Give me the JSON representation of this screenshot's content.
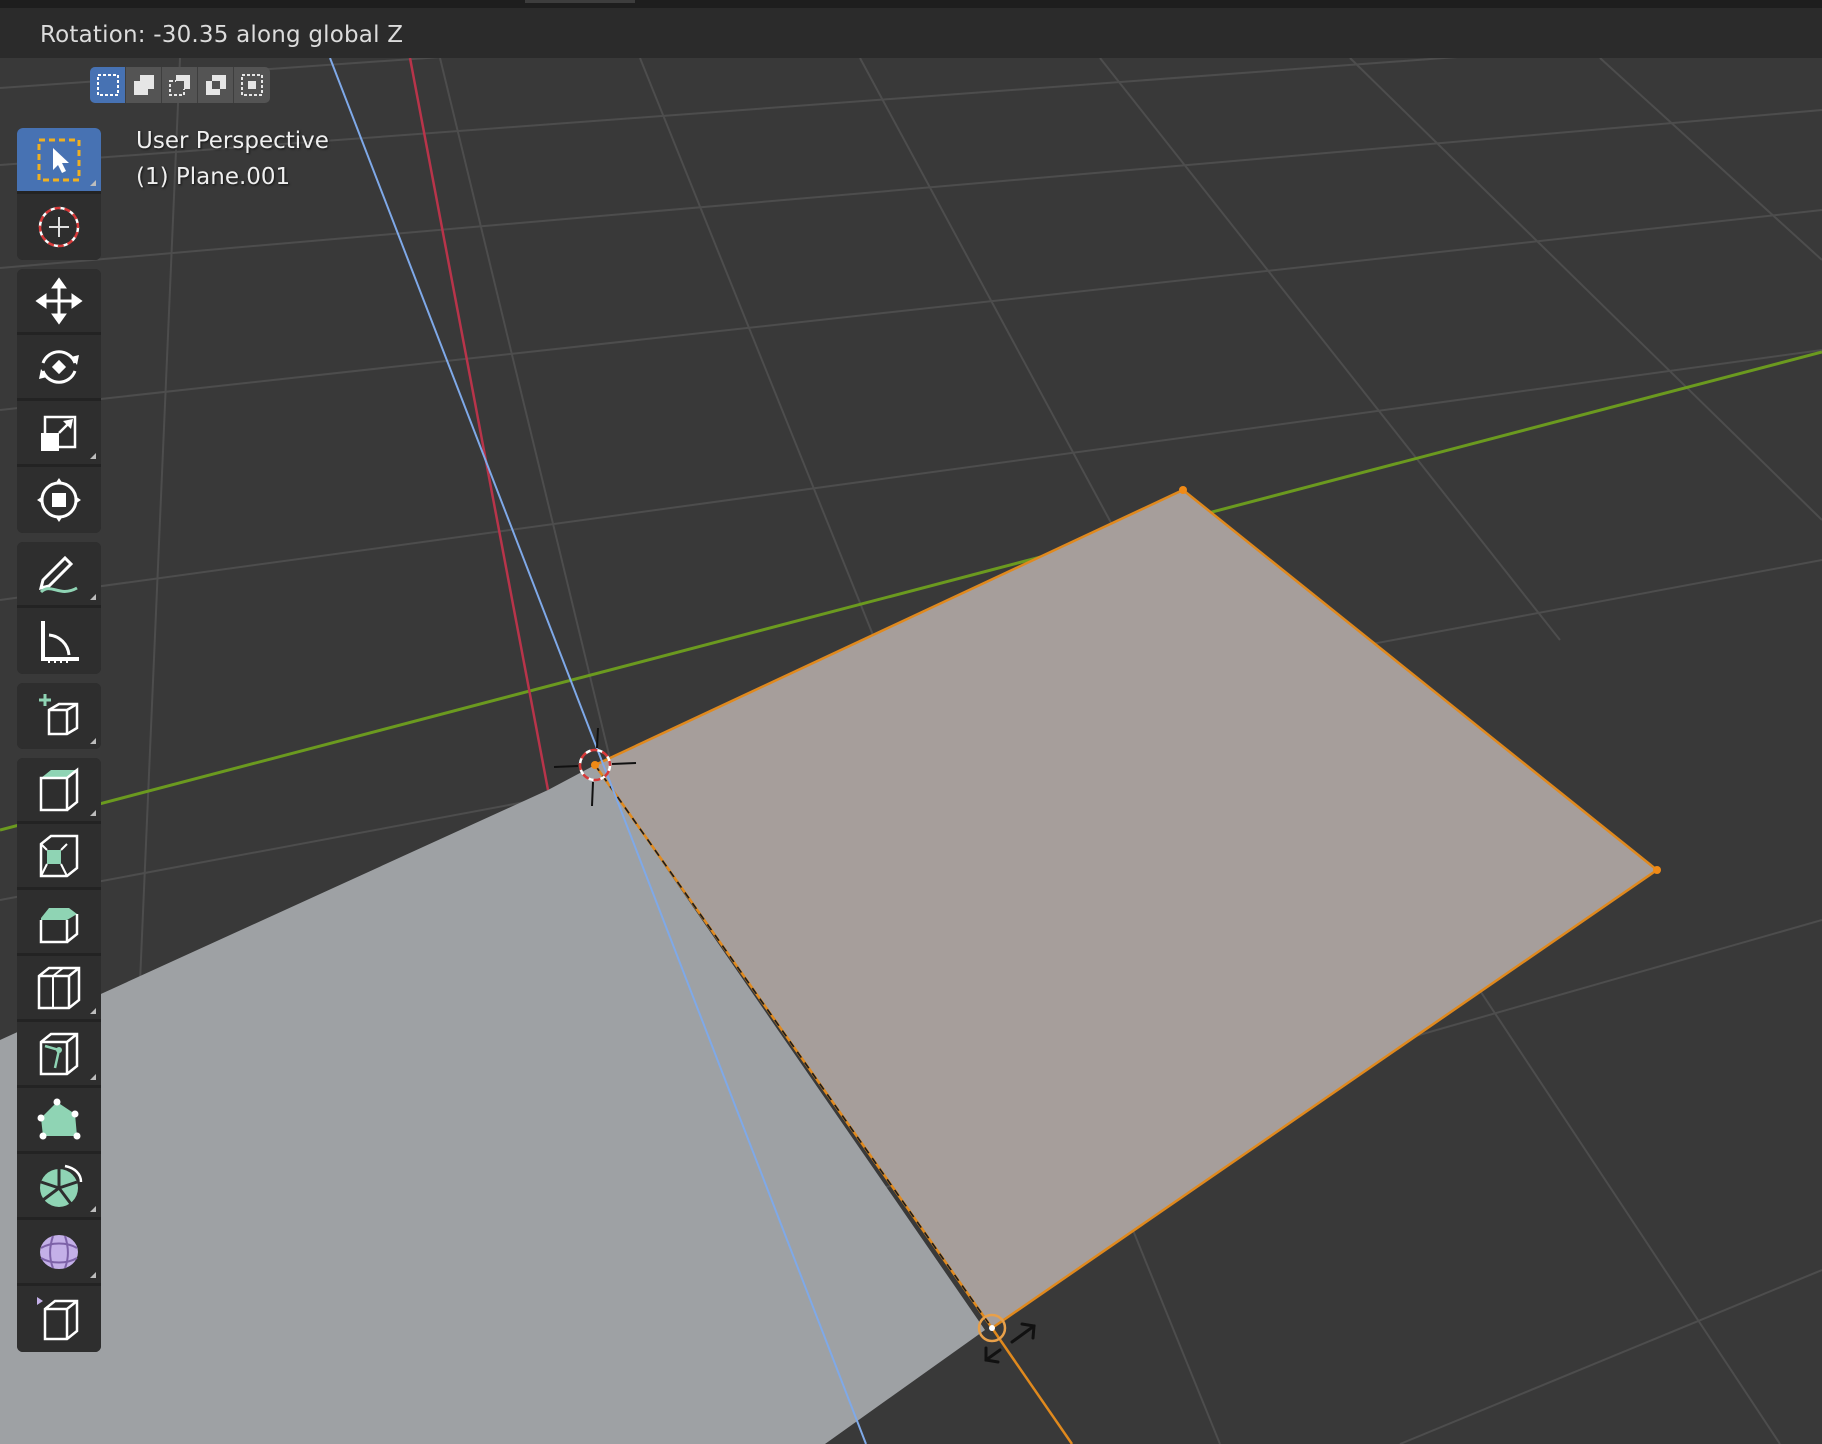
{
  "header": {
    "status_text": "Rotation: -30.35 along global Z"
  },
  "select_modes": [
    {
      "name": "mode-set-icon",
      "active": true
    },
    {
      "name": "mode-extend-icon",
      "active": false
    },
    {
      "name": "mode-subtract-icon",
      "active": false
    },
    {
      "name": "mode-difference-icon",
      "active": false
    },
    {
      "name": "mode-intersect-icon",
      "active": false
    }
  ],
  "viewport": {
    "view_name": "User Perspective",
    "object_name": "(1) Plane.001"
  },
  "toolbar": {
    "groups": [
      [
        "select-box-tool-icon",
        "cursor-tool-icon"
      ],
      [
        "move-tool-icon",
        "rotate-tool-icon",
        "scale-tool-icon",
        "transform-tool-icon"
      ],
      [
        "annotate-tool-icon",
        "measure-tool-icon"
      ],
      [
        "add-cube-tool-icon"
      ],
      [
        "extrude-region-tool-icon",
        "inset-faces-tool-icon",
        "bevel-tool-icon",
        "loop-cut-tool-icon",
        "knife-tool-icon",
        "poly-build-tool-icon",
        "spin-tool-icon",
        "smooth-tool-icon",
        "shrink-fatten-tool-icon"
      ]
    ],
    "active_tool": "select-box-tool-icon"
  },
  "colors": {
    "background": "#393939",
    "grid": "#4a4a4a",
    "axis_x": "#c8394a",
    "axis_y": "#6b9a1f",
    "axis_z": "#7fa9e8",
    "selection": "#e08a1e",
    "active_button": "#4772b3",
    "tool_accent": "#8fd4b4"
  }
}
